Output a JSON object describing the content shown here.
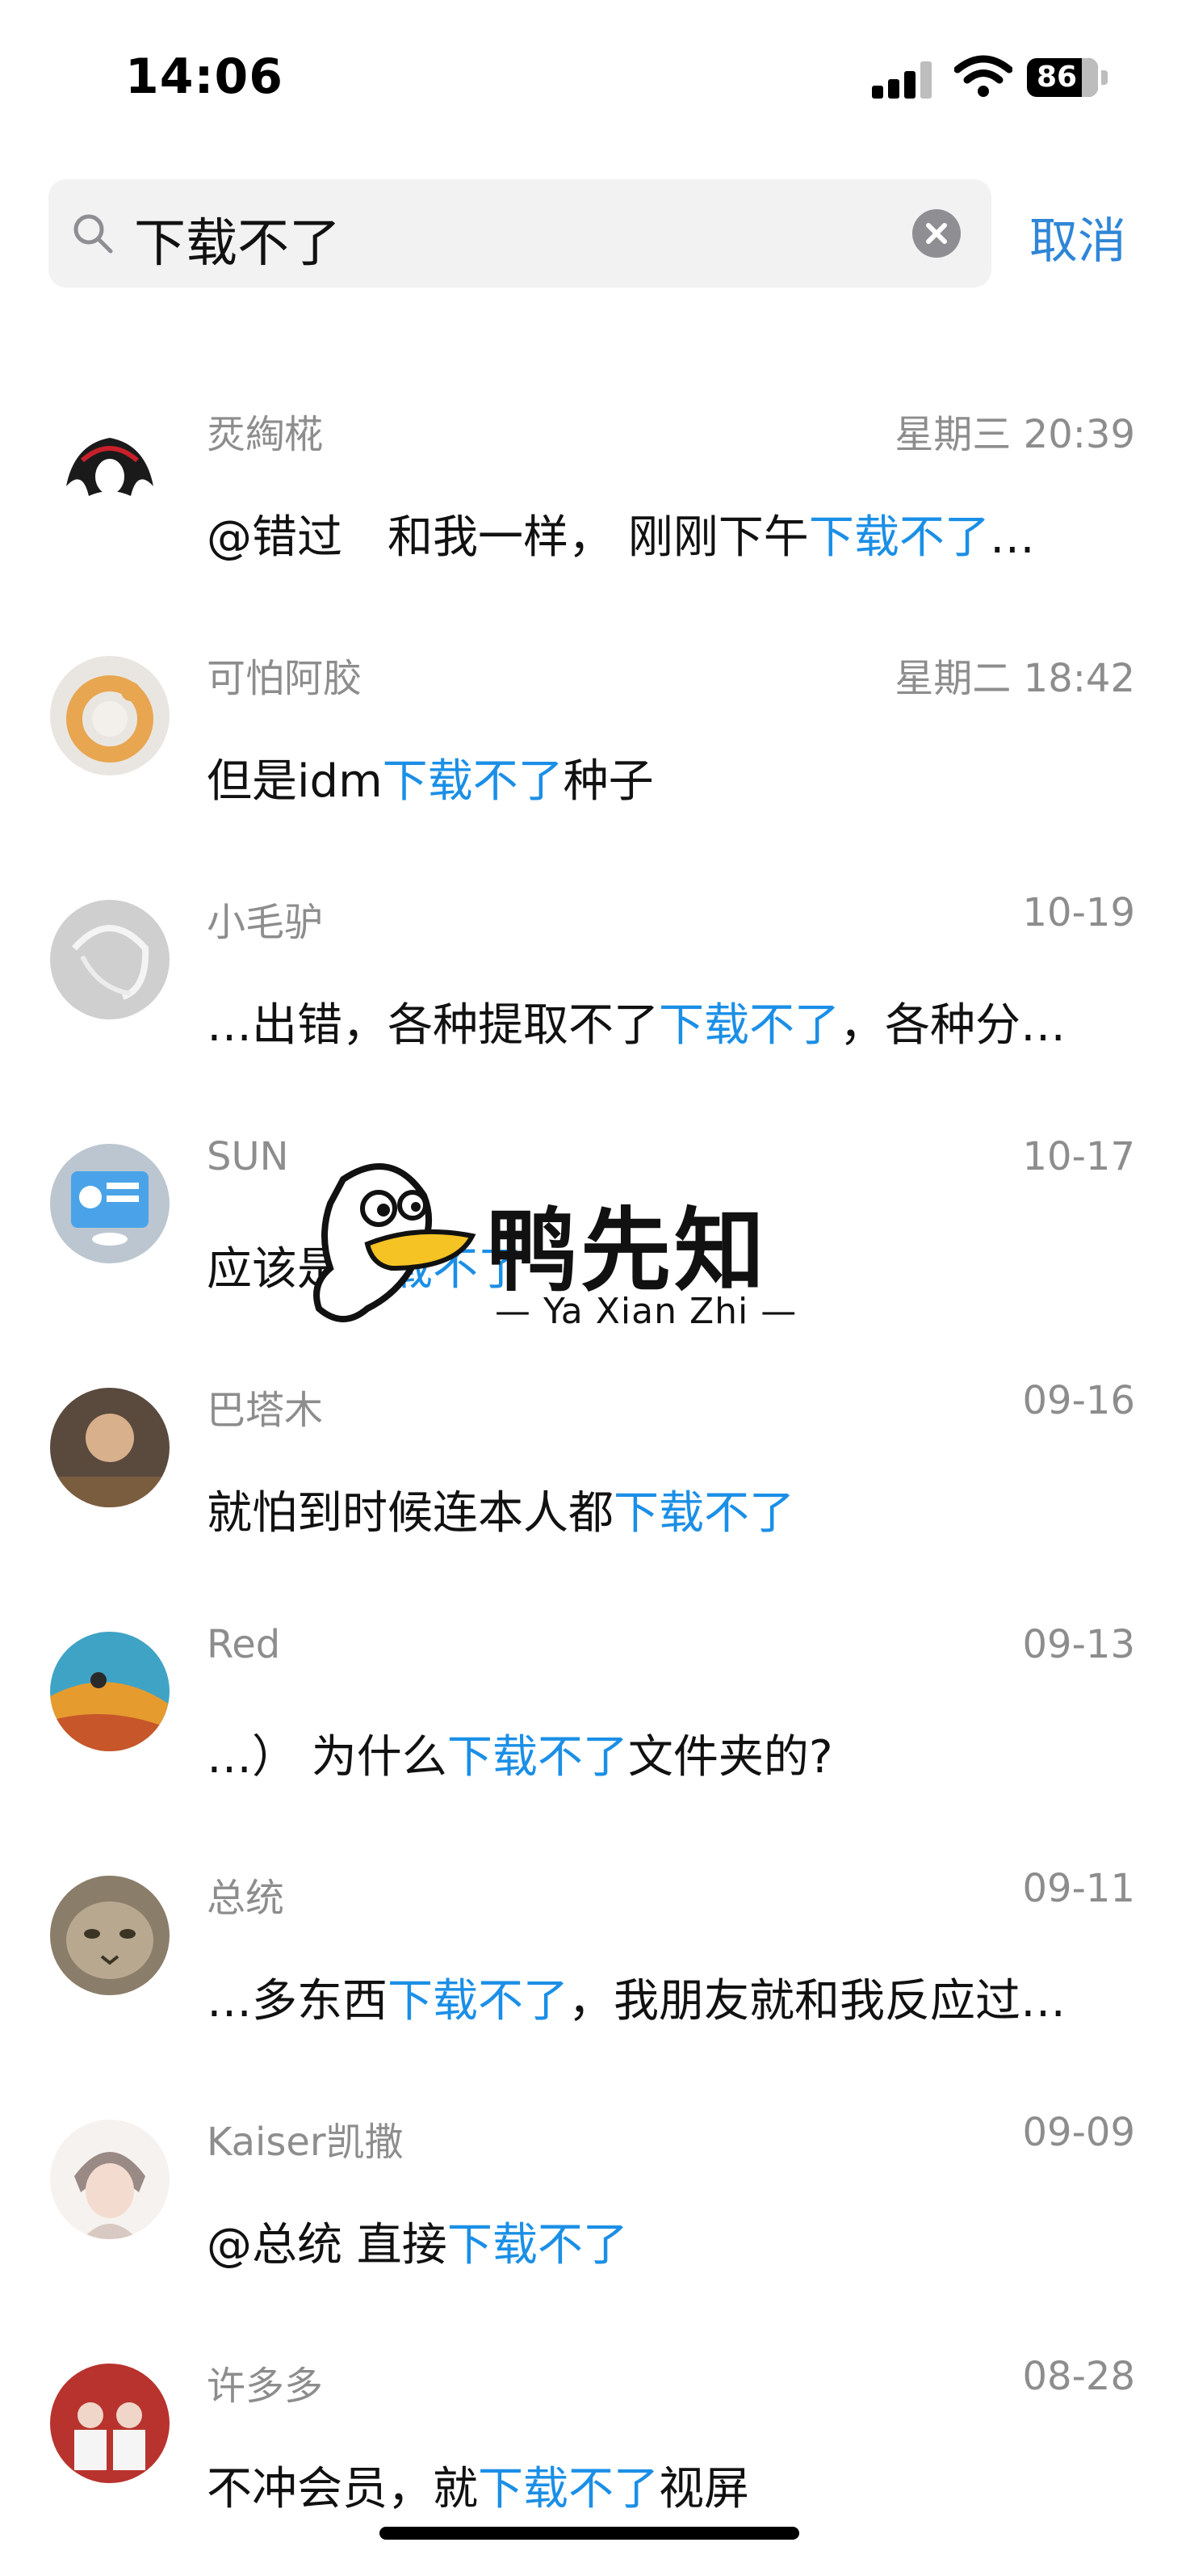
{
  "status_bar": {
    "time": "14:06",
    "battery": "86"
  },
  "search": {
    "query": "下载不了",
    "cancel_label": "取消"
  },
  "results": [
    {
      "name": "烎綯椛",
      "time": "星期三 20:39",
      "before": "@错过　和我一样，  刚刚下午",
      "highlight": "下载不了",
      "after": "…"
    },
    {
      "name": "可怕阿胶",
      "time": "星期二 18:42",
      "before": "但是idm",
      "highlight": "下载不了",
      "after": "种子"
    },
    {
      "name": "小毛驴",
      "time": "10-19",
      "before": "…出错，各种提取不了",
      "highlight": "下载不了",
      "after": "，各种分…"
    },
    {
      "name": "SUN",
      "time": "10-17",
      "before": "应该是",
      "highlight": "下载不了",
      "after": ""
    },
    {
      "name": "巴塔木",
      "time": "09-16",
      "before": "就怕到时候连本人都",
      "highlight": "下载不了",
      "after": ""
    },
    {
      "name": "Red",
      "time": "09-13",
      "before": "…）  为什么",
      "highlight": "下载不了",
      "after": "文件夹的?"
    },
    {
      "name": "总统",
      "time": "09-11",
      "before": "…多东西",
      "highlight": "下载不了",
      "after": "，我朋友就和我反应过…"
    },
    {
      "name": "Kaiser凯撒",
      "time": "09-09",
      "before": "@总统  直接",
      "highlight": "下载不了",
      "after": ""
    },
    {
      "name": "许多多",
      "time": "08-28",
      "before": "不冲会员，就",
      "highlight": "下载不了",
      "after": "视屏"
    }
  ],
  "watermark": {
    "title": "鸭先知",
    "subtitle": "— Ya Xian Zhi —"
  },
  "colors": {
    "highlight": "#1b8fe6",
    "cancel": "#2f86d7",
    "meta": "#8d8d8d"
  }
}
